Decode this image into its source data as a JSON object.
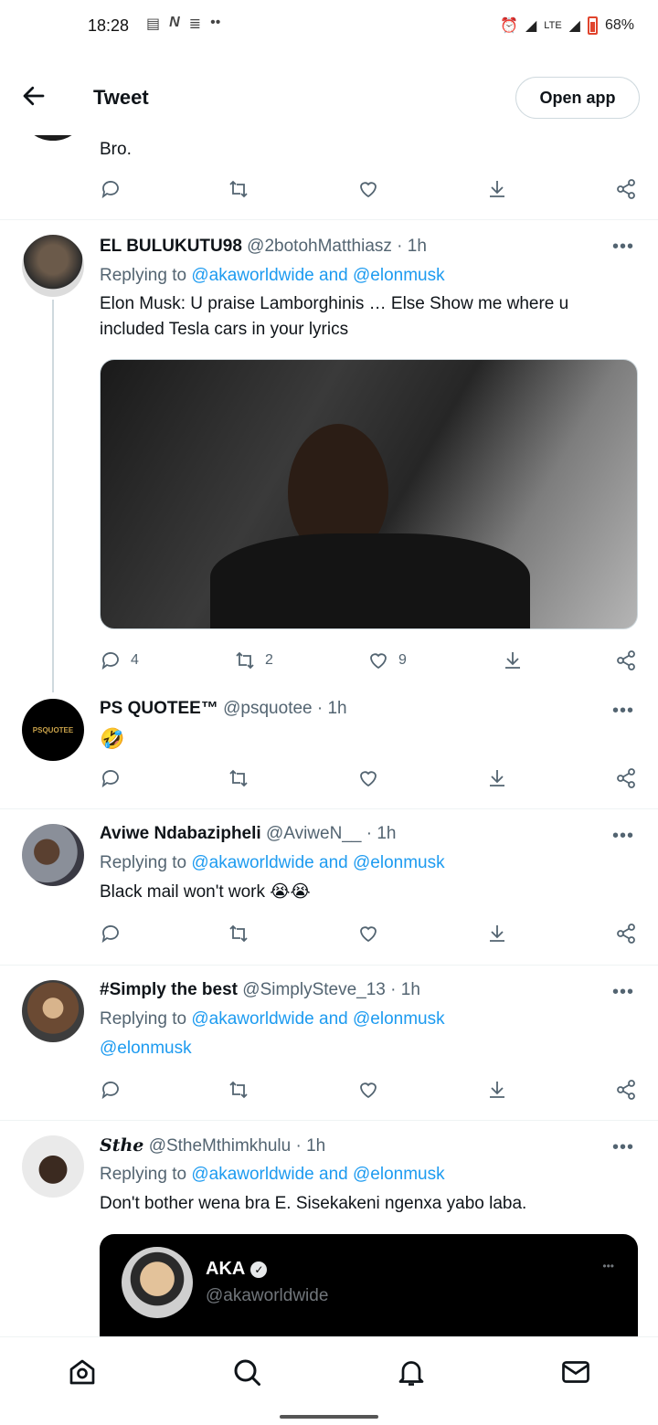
{
  "status_bar": {
    "time": "18:28",
    "network": "LTE",
    "battery": "68%"
  },
  "header": {
    "title": "Tweet",
    "open_app": "Open app"
  },
  "partial_tweet": {
    "text": "Bro."
  },
  "tweets": [
    {
      "name": "EL BULUKUTU98",
      "meta": "@2botohMatthiasz · 1h",
      "replying_prefix": "Replying to",
      "replying_to": "@akaworldwide and @elonmusk",
      "text": "Elon Musk: U praise Lamborghinis … Else Show me where u included Tesla cars in your lyrics",
      "replies": "4",
      "retweets": "2",
      "likes": "9"
    },
    {
      "name": "PS QUOTEE™",
      "meta": "@psquotee · 1h",
      "text": "🤣",
      "avatar_text": "PSQUOTEE"
    },
    {
      "name": "Aviwe Ndabazipheli",
      "meta": "@AviweN__ · 1h",
      "replying_prefix": "Replying to",
      "replying_to": "@akaworldwide and @elonmusk",
      "text": "Black mail won't work 😭😭"
    },
    {
      "name": "#Simply the best",
      "meta": "@SimplySteve_13 · 1h",
      "replying_prefix": "Replying to",
      "replying_to": "@akaworldwide and @elonmusk",
      "text": "@elonmusk"
    },
    {
      "name": "Sthe",
      "meta": "@StheMthimkhulu · 1h",
      "replying_prefix": "Replying to",
      "replying_to": "@akaworldwide and @elonmusk",
      "text": "Don't bother wena bra E. Sisekakeni ngenxa yabo laba."
    }
  ],
  "quoted": {
    "name": "AKA",
    "handle": "@akaworldwide"
  },
  "more_glyph": "•••",
  "colors": {
    "link": "#1d9bf0",
    "muted": "#536471",
    "divider": "#eff3f4"
  }
}
